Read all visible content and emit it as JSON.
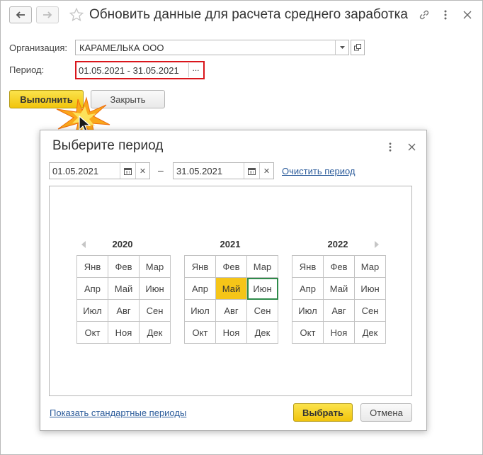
{
  "window": {
    "title": "Обновить данные для расчета среднего заработка"
  },
  "form": {
    "org_label": "Организация:",
    "org_value": "КАРАМЕЛЬКА ООО",
    "period_label": "Период:",
    "period_value": "01.05.2021 - 31.05.2021",
    "period_select_button": "...",
    "run_button": "Выполнить",
    "close_button": "Закрыть"
  },
  "dialog": {
    "title": "Выберите период",
    "date_from": "01.05.2021",
    "date_separator": "–",
    "date_to": "31.05.2021",
    "clear_link": "Очистить период",
    "standard_periods_link": "Показать стандартные периоды",
    "select_button": "Выбрать",
    "cancel_button": "Отмена",
    "years": [
      {
        "year": "2020",
        "months": [
          "Янв",
          "Фев",
          "Мар",
          "Апр",
          "Май",
          "Июн",
          "Июл",
          "Авг",
          "Сен",
          "Окт",
          "Ноя",
          "Дек"
        ]
      },
      {
        "year": "2021",
        "months": [
          "Янв",
          "Фев",
          "Мар",
          "Апр",
          "Май",
          "Июн",
          "Июл",
          "Авг",
          "Сен",
          "Окт",
          "Ноя",
          "Дек"
        ],
        "selected_month": "Май",
        "highlighted_month": "Июн"
      },
      {
        "year": "2022",
        "months": [
          "Янв",
          "Фев",
          "Мар",
          "Апр",
          "Май",
          "Июн",
          "Июл",
          "Авг",
          "Сен",
          "Окт",
          "Ноя",
          "Дек"
        ]
      }
    ]
  },
  "colors": {
    "accent_yellow": "#f5c518",
    "highlight_border": "#d9161c",
    "current_month_border": "#2e8b4a",
    "link": "#2c5c9b"
  }
}
